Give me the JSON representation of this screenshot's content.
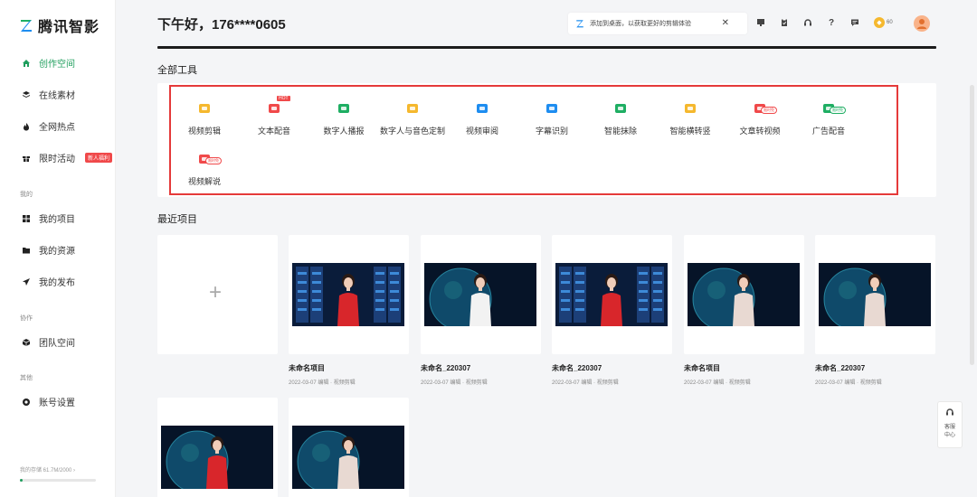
{
  "app": {
    "name": "腾讯智影",
    "brand_color": "#1f9e5d",
    "accent_red": "#e53a3a"
  },
  "sidebar": {
    "items": [
      {
        "label": "创作空间",
        "icon": "home-icon",
        "active": true
      },
      {
        "label": "在线素材",
        "icon": "layers-icon"
      },
      {
        "label": "全网热点",
        "icon": "flame-icon"
      },
      {
        "label": "限时活动",
        "icon": "gift-icon",
        "badge": "新人福利"
      }
    ],
    "section_mine": "我的",
    "mine_items": [
      {
        "label": "我的项目",
        "icon": "grid-icon"
      },
      {
        "label": "我的资源",
        "icon": "folder-icon"
      },
      {
        "label": "我的发布",
        "icon": "send-icon"
      }
    ],
    "section_collab": "协作",
    "collab_items": [
      {
        "label": "团队空间",
        "icon": "cube-icon"
      }
    ],
    "section_other": "其他",
    "other_items": [
      {
        "label": "账号设置",
        "icon": "gear-icon"
      }
    ],
    "storage_text": "我的存储 61.7M/2000 ›",
    "storage_fraction": 0.03
  },
  "header": {
    "greeting": "下午好，176****0605",
    "notice_text": "添加到桌面，以获取更好的剪辑体验",
    "close": "✕",
    "coins": "60",
    "icons": [
      "monitor-icon",
      "clipboard-icon",
      "headset-icon",
      "help-icon",
      "message-icon"
    ],
    "help_glyph": "?"
  },
  "tools": {
    "heading": "全部工具",
    "items": [
      {
        "label": "视频剪辑",
        "icon": "video-edit-icon",
        "color": "#f5b82e"
      },
      {
        "label": "文本配音",
        "icon": "text-voice-icon",
        "color": "#f0494a",
        "tag": "HOT"
      },
      {
        "label": "数字人播报",
        "icon": "avatar-broadcast-icon",
        "color": "#1fae63"
      },
      {
        "label": "数字人与音色定制",
        "icon": "custom-avatar-icon",
        "color": "#f5b82e"
      },
      {
        "label": "视频审阅",
        "icon": "video-review-icon",
        "color": "#1e8df0"
      },
      {
        "label": "字幕识别",
        "icon": "subtitle-icon",
        "color": "#1e8df0"
      },
      {
        "label": "智能抹除",
        "icon": "erase-icon",
        "color": "#1fae63"
      },
      {
        "label": "智能横转竖",
        "icon": "rotate-icon",
        "color": "#f5b82e"
      },
      {
        "label": "文章转视频",
        "icon": "article-video-icon",
        "color": "#f0494a",
        "tag": "限时免"
      },
      {
        "label": "广告配音",
        "icon": "ad-voice-icon",
        "color": "#1fae63",
        "tag": "限时免"
      },
      {
        "label": "视频解说",
        "icon": "video-narrate-icon",
        "color": "#f0494a",
        "tag": "限时免"
      }
    ]
  },
  "recent": {
    "heading": "最近项目",
    "new_glyph": "+",
    "projects": [
      {
        "name": "未命名项目",
        "meta": "2022-03-07 编辑 · 视频剪辑",
        "dress": "#d8262b",
        "bg": "server"
      },
      {
        "name": "未命名_220307",
        "meta": "2022-03-07 编辑 · 视频剪辑",
        "dress": "#f2f2f2",
        "bg": "globe"
      },
      {
        "name": "未命名_220307",
        "meta": "2022-03-07 编辑 · 视频剪辑",
        "dress": "#d8262b",
        "bg": "server"
      },
      {
        "name": "未命名项目",
        "meta": "2022-03-07 编辑 · 视频剪辑",
        "dress": "#e8d9d2",
        "bg": "globe"
      },
      {
        "name": "未命名_220307",
        "meta": "2022-03-07 编辑 · 视频剪辑",
        "dress": "#e8d9d2",
        "bg": "globe"
      },
      {
        "name": "",
        "meta": "",
        "dress": "#d8262b",
        "bg": "globe"
      },
      {
        "name": "",
        "meta": "",
        "dress": "#e8d9d2",
        "bg": "globe"
      }
    ]
  },
  "service": {
    "label_1": "客服",
    "label_2": "中心"
  }
}
